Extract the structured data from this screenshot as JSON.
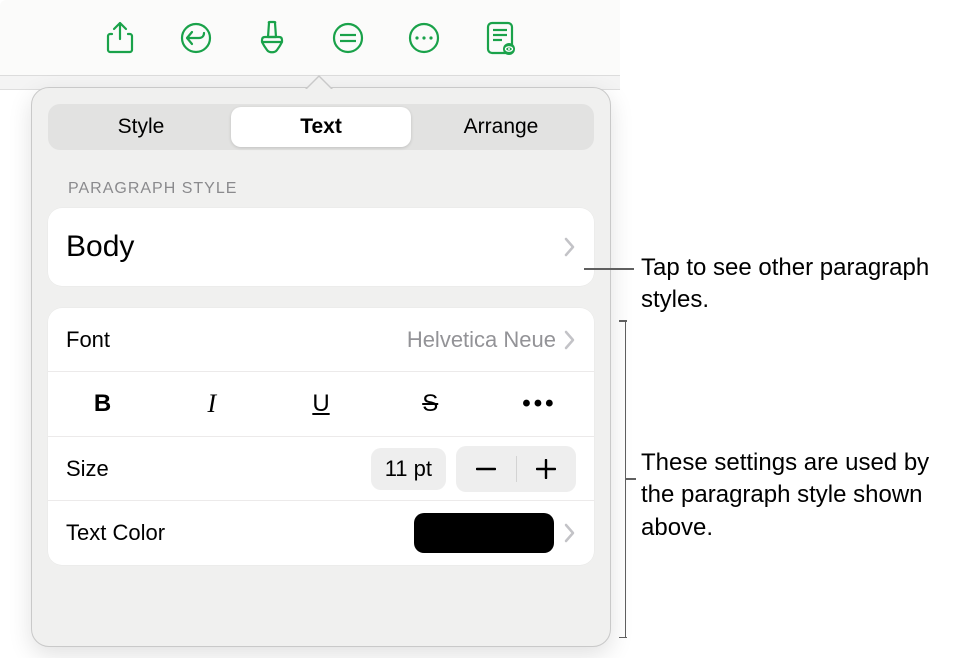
{
  "toolbar": {
    "icons": [
      "share",
      "undo",
      "format-brush",
      "comment",
      "more",
      "view-options"
    ]
  },
  "tabs": {
    "items": [
      "Style",
      "Text",
      "Arrange"
    ],
    "activeIndex": 1
  },
  "paragraph_section_label": "PARAGRAPH STYLE",
  "paragraph_style": {
    "name": "Body"
  },
  "font": {
    "label": "Font",
    "value": "Helvetica Neue"
  },
  "styleButtons": {
    "bold": "B",
    "italic": "I",
    "underline": "U",
    "strike": "S",
    "more": "•••"
  },
  "size": {
    "label": "Size",
    "value": "11 pt"
  },
  "textColor": {
    "label": "Text Color",
    "value": "#000000"
  },
  "callouts": {
    "paragraphStyles": "Tap to see other paragraph styles.",
    "settingsUsed": "These settings are used by the paragraph style shown above."
  }
}
